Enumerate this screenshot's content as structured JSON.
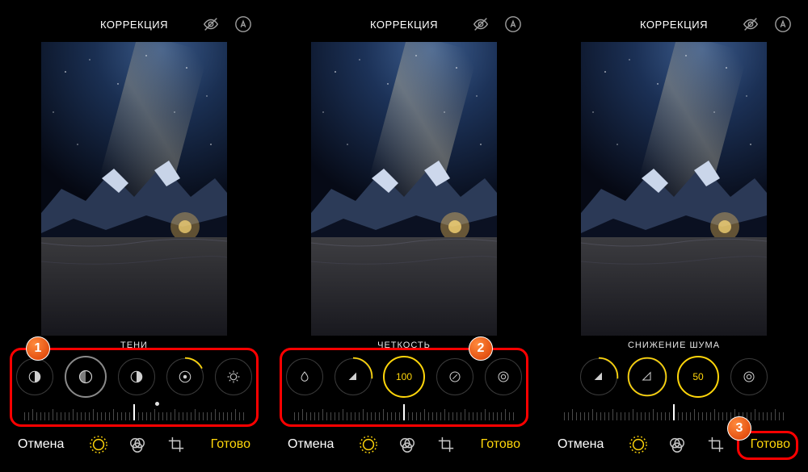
{
  "header": {
    "title": "КОРРЕКЦИЯ"
  },
  "panels": {
    "p1": {
      "label": "ТЕНИ"
    },
    "p2": {
      "label": "ЧЕТКОСТЬ",
      "value": "100"
    },
    "p3": {
      "label": "СНИЖЕНИЕ ШУМА",
      "value": "50"
    }
  },
  "bottom": {
    "cancel": "Отмена",
    "done": "Готово"
  },
  "badges": {
    "b1": "1",
    "b2": "2",
    "b3": "3"
  }
}
